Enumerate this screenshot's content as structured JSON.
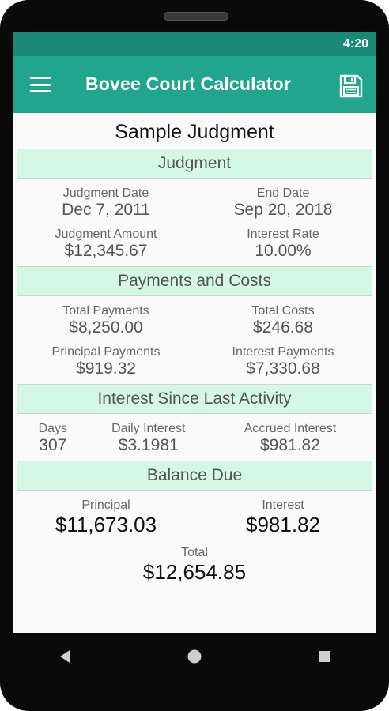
{
  "status_bar": {
    "time": "4:20"
  },
  "app_bar": {
    "title": "Bovee Court Calculator",
    "menu_icon": "menu-icon",
    "save_icon": "save-icon"
  },
  "document": {
    "title": "Sample Judgment"
  },
  "judgment": {
    "header": "Judgment",
    "judgment_date_label": "Judgment Date",
    "judgment_date": "Dec 7, 2011",
    "end_date_label": "End Date",
    "end_date": "Sep 20, 2018",
    "amount_label": "Judgment Amount",
    "amount": "$12,345.67",
    "rate_label": "Interest Rate",
    "rate": "10.00%"
  },
  "payments": {
    "header": "Payments and Costs",
    "total_payments_label": "Total Payments",
    "total_payments": "$8,250.00",
    "total_costs_label": "Total Costs",
    "total_costs": "$246.68",
    "principal_payments_label": "Principal Payments",
    "principal_payments": "$919.32",
    "interest_payments_label": "Interest Payments",
    "interest_payments": "$7,330.68"
  },
  "interest_since": {
    "header": "Interest Since Last Activity",
    "days_label": "Days",
    "days": "307",
    "daily_label": "Daily Interest",
    "daily": "$3.1981",
    "accrued_label": "Accrued Interest",
    "accrued": "$981.82"
  },
  "balance": {
    "header": "Balance Due",
    "principal_label": "Principal",
    "principal": "$11,673.03",
    "interest_label": "Interest",
    "interest": "$981.82",
    "total_label": "Total",
    "total": "$12,654.85"
  },
  "colors": {
    "status_bar": "#1a8a76",
    "app_bar": "#22a58d",
    "section_header": "#d5f7e5"
  },
  "nav_icons": [
    "back-icon",
    "home-icon",
    "recents-icon"
  ]
}
